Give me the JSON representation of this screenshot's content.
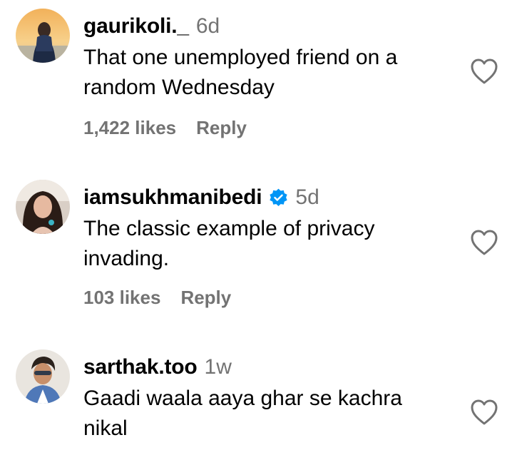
{
  "comments": [
    {
      "username": "gaurikoli._",
      "time": "6d",
      "verified": false,
      "text": "That one unemployed friend on a\nrandom Wednesday",
      "likes": "1,422 likes",
      "reply": "Reply"
    },
    {
      "username": "iamsukhmanibedi",
      "time": "5d",
      "verified": true,
      "text": "The classic example of privacy\ninvading.",
      "likes": "103 likes",
      "reply": "Reply"
    },
    {
      "username": "sarthak.too",
      "time": "1w",
      "verified": false,
      "text": "Gaadi waala aaya ghar se kachra\nnikal",
      "likes": "",
      "reply": ""
    }
  ],
  "colors": {
    "text": "#000000",
    "secondary": "#737373",
    "verified": "#0095f6"
  },
  "icons": {
    "like": "heart-outline-icon",
    "verified": "verified-badge-icon"
  }
}
